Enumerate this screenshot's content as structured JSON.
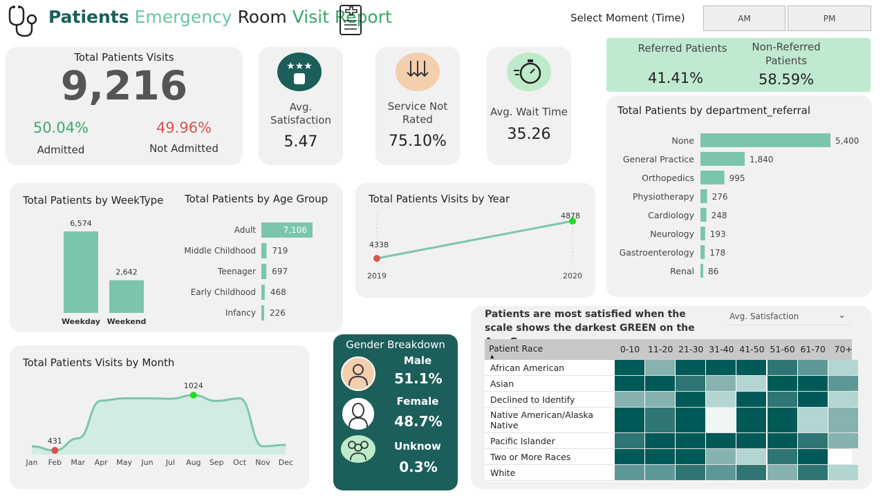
{
  "header": {
    "title_w1": "Patients",
    "title_w2": "Emergency",
    "title_w3": "Room",
    "title_w4": "Visit Report",
    "moment_label": "Select Moment (Time)",
    "am_label": "AM",
    "pm_label": "PM"
  },
  "colors": {
    "accent": "#7cc5ad",
    "dark_teal": "#1b5e5a",
    "red": "#d9534f",
    "green_text": "#3aa86b",
    "referred_bg": "#c0ead0"
  },
  "kpi": {
    "visits_label": "Total Patients Visits",
    "visits_value": "9,216",
    "admitted_pct": "50.04%",
    "admitted_label": "Admitted",
    "not_admitted_pct": "49.96%",
    "not_admitted_label": "Not Admitted",
    "satisfaction_label": "Avg. Satisfaction",
    "satisfaction_value": "5.47",
    "not_rated_label": "Service Not Rated",
    "not_rated_value": "75.10%",
    "wait_label": "Avg. Wait Time",
    "wait_value": "35.26",
    "referred_label": "Referred Patients",
    "referred_value": "41.41%",
    "nonreferred_label": "Non-Referred Patients",
    "nonreferred_value": "58.59%"
  },
  "gender": {
    "title": "Gender Breakdown",
    "male_label": "Male",
    "male_value": "51.1%",
    "female_label": "Female",
    "female_value": "48.7%",
    "unknown_label": "Unknow",
    "unknown_value": "0.3%"
  },
  "heatmap": {
    "title": "Patients are most satisfied when the scale shows the darkest GREEN on the Age-Group",
    "dropdown_value": "Avg. Satisfaction",
    "row_header": "Patient Race",
    "columns": [
      "0-10",
      "11-20",
      "21-30",
      "31-40",
      "41-50",
      "51-60",
      "61-70",
      "70+"
    ],
    "rows": [
      {
        "label": "African American",
        "levels": [
          5,
          2,
          5,
          5,
          5,
          4,
          3,
          1
        ]
      },
      {
        "label": "Asian",
        "levels": [
          5,
          5,
          4,
          2,
          1,
          5,
          5,
          3
        ]
      },
      {
        "label": "Declined to Identify",
        "levels": [
          2,
          2,
          5,
          1,
          5,
          4,
          5,
          1
        ]
      },
      {
        "label": "Native American/Alaska Native",
        "levels": [
          5,
          4,
          5,
          0,
          5,
          5,
          1,
          2
        ]
      },
      {
        "label": "Pacific Islander",
        "levels": [
          4,
          5,
          5,
          5,
          5,
          5,
          4,
          2
        ]
      },
      {
        "label": "Two or More Races",
        "levels": [
          5,
          5,
          5,
          2,
          1,
          4,
          5,
          -1
        ]
      },
      {
        "label": "White",
        "levels": [
          3,
          3,
          4,
          3,
          4,
          2,
          4,
          1
        ]
      }
    ]
  },
  "chart_data": [
    {
      "type": "bar",
      "title": "Total Patients by WeekType",
      "categories": [
        "Weekday",
        "Weekend"
      ],
      "values": [
        6574,
        2642
      ],
      "value_labels": [
        "6,574",
        "2,642"
      ]
    },
    {
      "type": "bar",
      "orientation": "horizontal",
      "title": "Total Patients by Age Group",
      "categories": [
        "Adult",
        "Middle Childhood",
        "Teenager",
        "Early Childhood",
        "Infancy"
      ],
      "values": [
        7106,
        719,
        697,
        468,
        226
      ],
      "value_labels": [
        "7,106",
        "719",
        "697",
        "468",
        "226"
      ]
    },
    {
      "type": "line",
      "title": "Total Patients Visits by Year",
      "x": [
        "2019",
        "2020"
      ],
      "values": [
        4338,
        4878
      ],
      "value_labels": [
        "4338",
        "4878"
      ]
    },
    {
      "type": "bar",
      "orientation": "horizontal",
      "title": "Total Patients by department_referral",
      "categories": [
        "None",
        "General Practice",
        "Orthopedics",
        "Physiotherapy",
        "Cardiology",
        "Neurology",
        "Gastroenterology",
        "Renal"
      ],
      "values": [
        5400,
        1840,
        995,
        276,
        248,
        193,
        178,
        86
      ],
      "value_labels": [
        "5,400",
        "1,840",
        "995",
        "276",
        "248",
        "193",
        "178",
        "86"
      ]
    },
    {
      "type": "area",
      "title": "Total Patients Visits by Month",
      "x": [
        "Jan",
        "Feb",
        "Mar",
        "Apr",
        "May",
        "Jun",
        "Jul",
        "Aug",
        "Sep",
        "Oct",
        "Nov",
        "Dec"
      ],
      "values": [
        475,
        431,
        560,
        965,
        990,
        990,
        985,
        1024,
        962,
        990,
        475,
        490
      ],
      "value_labels": {
        "Feb": "431",
        "Aug": "1024"
      }
    }
  ]
}
